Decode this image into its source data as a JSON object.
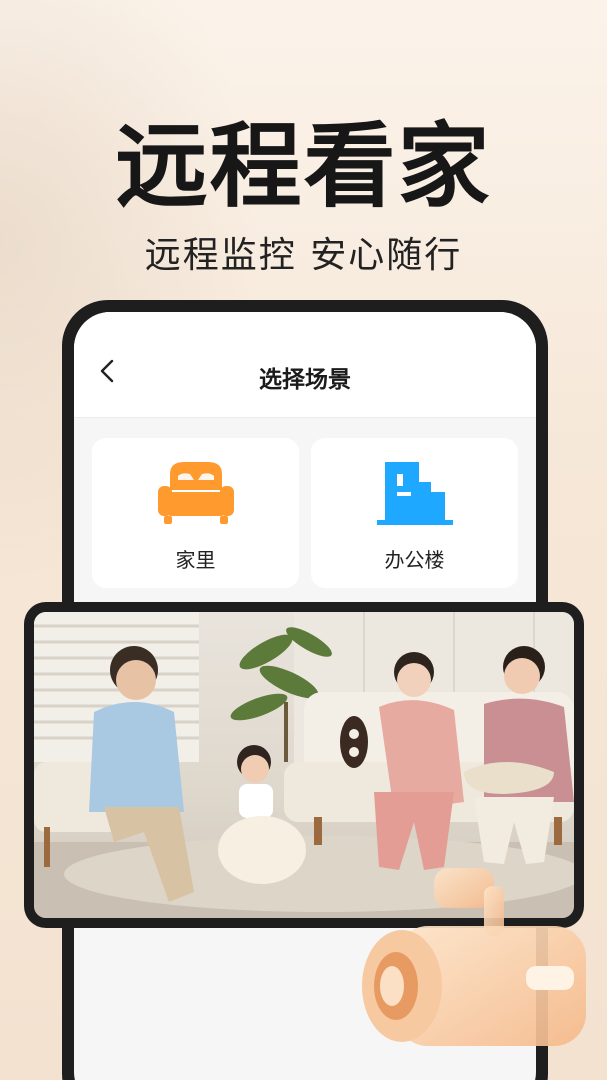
{
  "banner": {
    "headline": "远程看家",
    "subline": "远程监控 安心随行"
  },
  "screen": {
    "title": "选择场景",
    "scenes": [
      {
        "label": "家里",
        "icon": "sofa-icon",
        "color": "#FF9A2E"
      },
      {
        "label": "办公楼",
        "icon": "office-building-icon",
        "color": "#1FA8FF"
      }
    ]
  },
  "colors": {
    "background": "#F8EDE2",
    "phone_bezel": "#1E1E1E",
    "sofa_orange": "#FF9A2E",
    "building_blue": "#1FA8FF"
  }
}
